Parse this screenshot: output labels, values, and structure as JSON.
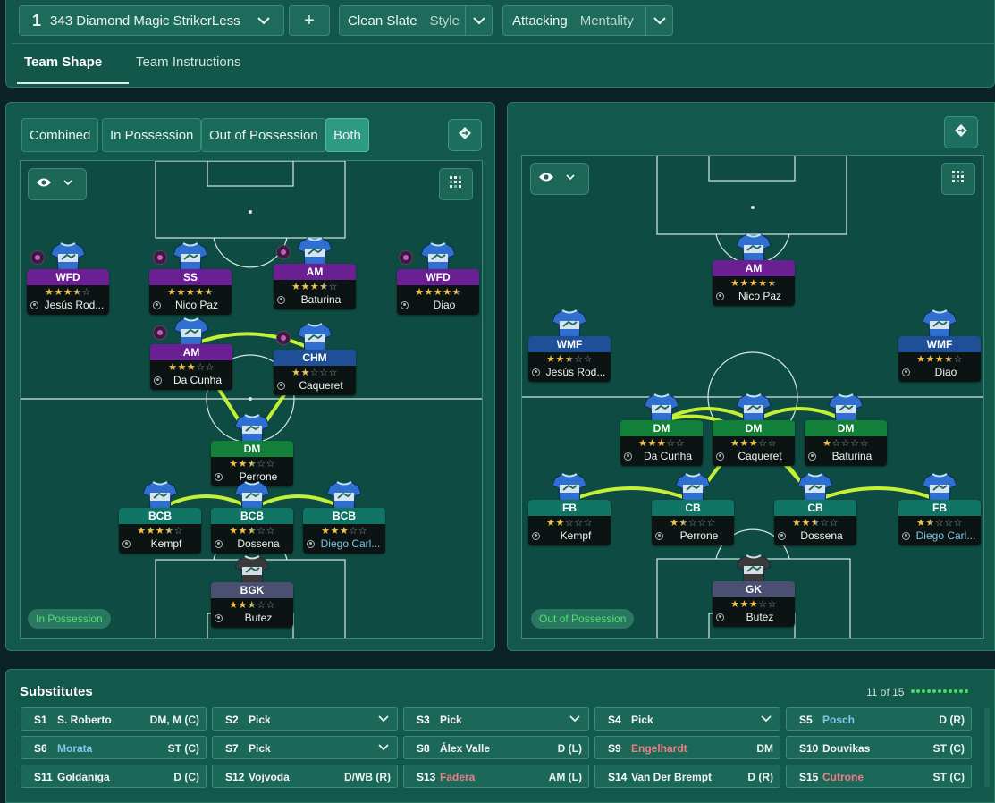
{
  "colors": {
    "accent_line": "#c4f135",
    "fwd": "#6a1f93",
    "mid": "#1f4f96",
    "dm": "#13803a",
    "def": "#107565",
    "gk": "#4b4f72"
  },
  "topbar": {
    "tactic_number": "1",
    "tactic_name": "343 Diamond Magic StrikerLess",
    "add_label": "+",
    "style_value": "Clean Slate",
    "style_label": "Style",
    "mentality_value": "Attacking",
    "mentality_label": "Mentality"
  },
  "tabs": [
    {
      "label": "Team Shape"
    },
    {
      "label": "Team Instructions"
    }
  ],
  "left": {
    "segments": [
      {
        "label": "Combined"
      },
      {
        "label": "In Possession"
      },
      {
        "label": "Out of Possession"
      },
      {
        "label": "Both"
      }
    ],
    "phase_label": "In Possession",
    "players": [
      {
        "role": "WFD",
        "stars": 3.5,
        "name": "Jesús Rod...",
        "blue": false
      },
      {
        "role": "SS",
        "stars": 4.5,
        "name": "Nico Paz",
        "blue": false
      },
      {
        "role": "AM",
        "stars": 3.5,
        "name": "Baturina",
        "blue": false
      },
      {
        "role": "WFD",
        "stars": 4.5,
        "name": "Diao",
        "blue": false
      },
      {
        "role": "AM",
        "stars": 3,
        "name": "Da Cunha",
        "blue": false
      },
      {
        "role": "CHM",
        "stars": 2,
        "name": "Caqueret",
        "blue": false
      },
      {
        "role": "DM",
        "stars": 2.5,
        "name": "Perrone",
        "blue": false
      },
      {
        "role": "BCB",
        "stars": 3.5,
        "name": "Kempf",
        "blue": false
      },
      {
        "role": "BCB",
        "stars": 2.5,
        "name": "Dossena",
        "blue": false
      },
      {
        "role": "BCB",
        "stars": 3,
        "name": "Diego Carl...",
        "blue": true
      },
      {
        "role": "BGK",
        "stars": 2.5,
        "name": "Butez",
        "blue": false
      }
    ]
  },
  "right": {
    "phase_label": "Out of Possession",
    "players": [
      {
        "role": "AM",
        "stars": 4.5,
        "name": "Nico Paz",
        "blue": false
      },
      {
        "role": "WMF",
        "stars": 2.5,
        "name": "Jesús Rod...",
        "blue": false
      },
      {
        "role": "WMF",
        "stars": 3.5,
        "name": "Diao",
        "blue": false
      },
      {
        "role": "DM",
        "stars": 3,
        "name": "Da Cunha",
        "blue": false
      },
      {
        "role": "DM",
        "stars": 3,
        "name": "Caqueret",
        "blue": false
      },
      {
        "role": "DM",
        "stars": 1,
        "name": "Baturina",
        "blue": false
      },
      {
        "role": "FB",
        "stars": 2,
        "name": "Kempf",
        "blue": false
      },
      {
        "role": "CB",
        "stars": 1.5,
        "name": "Perrone",
        "blue": false
      },
      {
        "role": "CB",
        "stars": 2.5,
        "name": "Dossena",
        "blue": false
      },
      {
        "role": "FB",
        "stars": 1.5,
        "name": "Diego Carl...",
        "blue": true
      },
      {
        "role": "GK",
        "stars": 3,
        "name": "Butez",
        "blue": false
      }
    ]
  },
  "subs": {
    "title": "Substitutes",
    "count": "11 of 15",
    "items": [
      {
        "id": "S1",
        "name": "S. Roberto",
        "pos": "DM, M (C)",
        "tone": ""
      },
      {
        "id": "S2",
        "name": "Pick",
        "pos": "",
        "tone": ""
      },
      {
        "id": "S3",
        "name": "Pick",
        "pos": "",
        "tone": ""
      },
      {
        "id": "S4",
        "name": "Pick",
        "pos": "",
        "tone": ""
      },
      {
        "id": "S5",
        "name": "Posch",
        "pos": "D (R)",
        "tone": "blue"
      },
      {
        "id": "S6",
        "name": "Morata",
        "pos": "ST (C)",
        "tone": "blue"
      },
      {
        "id": "S7",
        "name": "Pick",
        "pos": "",
        "tone": ""
      },
      {
        "id": "S8",
        "name": "Álex Valle",
        "pos": "D (L)",
        "tone": ""
      },
      {
        "id": "S9",
        "name": "Engelhardt",
        "pos": "DM",
        "tone": "red"
      },
      {
        "id": "S10",
        "name": "Douvikas",
        "pos": "ST (C)",
        "tone": ""
      },
      {
        "id": "S11",
        "name": "Goldaniga",
        "pos": "D (C)",
        "tone": ""
      },
      {
        "id": "S12",
        "name": "Vojvoda",
        "pos": "D/WB (R)",
        "tone": ""
      },
      {
        "id": "S13",
        "name": "Fadera",
        "pos": "AM (L)",
        "tone": "red"
      },
      {
        "id": "S14",
        "name": "Van Der Brempt",
        "pos": "D (R)",
        "tone": ""
      },
      {
        "id": "S15",
        "name": "Cutrone",
        "pos": "ST (C)",
        "tone": "red"
      }
    ]
  }
}
